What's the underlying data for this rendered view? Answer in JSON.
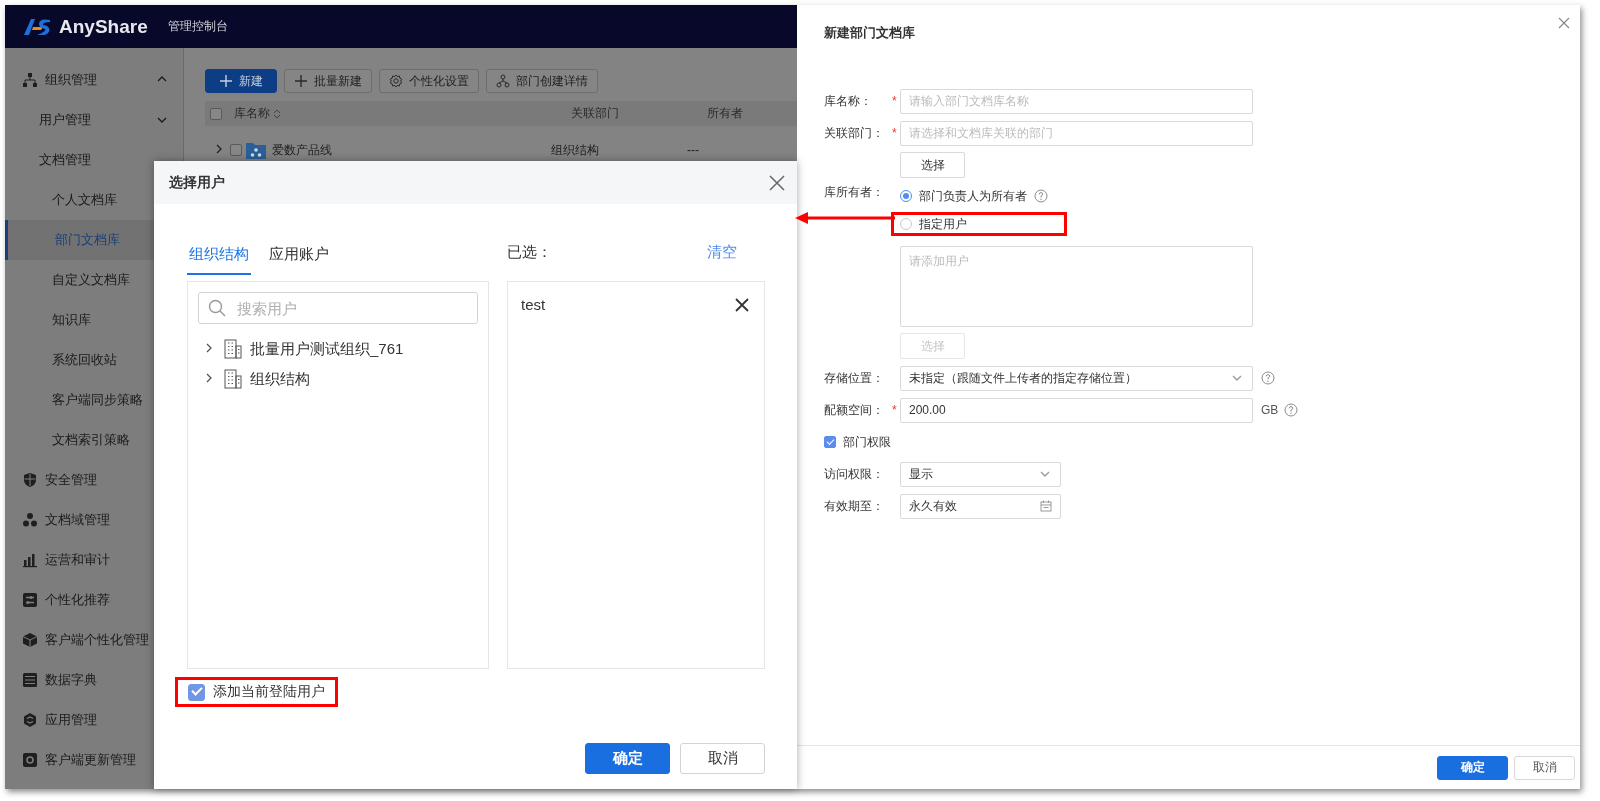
{
  "header": {
    "brand": "AnyShare",
    "subtitle": "管理控制台"
  },
  "sidebar": {
    "items": [
      {
        "label": "组织管理",
        "selected": false,
        "expanded": true,
        "children": [
          {
            "label": "用户管理",
            "selected": false,
            "expanded": false
          },
          {
            "label": "文档管理",
            "selected": false,
            "children": [
              {
                "label": "个人文档库",
                "selected": false
              },
              {
                "label": "部门文档库",
                "selected": true
              },
              {
                "label": "自定义文档库",
                "selected": false
              },
              {
                "label": "知识库",
                "selected": false
              },
              {
                "label": "系统回收站",
                "selected": false
              },
              {
                "label": "客户端同步策略",
                "selected": false
              },
              {
                "label": "文档索引策略",
                "selected": false
              }
            ]
          }
        ]
      },
      {
        "label": "安全管理",
        "selected": false
      },
      {
        "label": "文档域管理",
        "selected": false
      },
      {
        "label": "运营和审计",
        "selected": false
      },
      {
        "label": "个性化推荐",
        "selected": false
      },
      {
        "label": "客户端个性化管理",
        "selected": false
      },
      {
        "label": "数据字典",
        "selected": false
      },
      {
        "label": "应用管理",
        "selected": false
      },
      {
        "label": "客户端更新管理",
        "selected": false
      }
    ]
  },
  "toolbar": {
    "buttons": [
      {
        "label": "新建",
        "kind": "primary"
      },
      {
        "label": "批量新建",
        "kind": "default"
      },
      {
        "label": "个性化设置",
        "kind": "default"
      },
      {
        "label": "部门创建详情",
        "kind": "default"
      }
    ]
  },
  "table": {
    "all_checked": false,
    "columns": [
      {
        "label": "库名称",
        "sortable": true
      },
      {
        "label": "关联部门",
        "sortable": false
      },
      {
        "label": "所有者",
        "sortable": false
      }
    ],
    "rows": [
      {
        "checked": false,
        "expanded": false,
        "cells": [
          "爱数产品线",
          "组织结构",
          "---"
        ]
      }
    ]
  },
  "dialog": {
    "title": "选择用户",
    "tabs": [
      {
        "label": "组织结构",
        "selected": true
      },
      {
        "label": "应用账户",
        "selected": false
      }
    ],
    "selected_heading": "已选：",
    "clear_link": "清空",
    "search": {
      "placeholder": "搜索用户"
    },
    "tree": [
      {
        "label": "批量用户测试组织_761",
        "expanded": false
      },
      {
        "label": "组织结构",
        "expanded": false
      }
    ],
    "selected_users": [
      {
        "label": "test"
      }
    ],
    "add_current_user": {
      "label": "添加当前登陆用户",
      "checked": true,
      "highlighted": true
    },
    "buttons": [
      {
        "label": "确定",
        "kind": "primary"
      },
      {
        "label": "取消",
        "kind": "default"
      }
    ]
  },
  "drawer": {
    "title": "新建部门文档库",
    "form": [
      {
        "kind": "input",
        "label": "库名称：",
        "required_mark": "*",
        "placeholder": "请输入部门文档库名称"
      },
      {
        "kind": "input",
        "label": "关联部门：",
        "required_mark": "*",
        "placeholder": "请选择和文档库关联的部门"
      },
      {
        "kind": "button",
        "label": "选择",
        "disabled": false
      },
      {
        "kind": "radio",
        "label": "库所有者：",
        "options": [
          {
            "label": "部门负责人为所有者",
            "selected": true,
            "help": true,
            "highlighted": false
          },
          {
            "label": "指定用户",
            "selected": false,
            "highlighted": true
          }
        ]
      },
      {
        "kind": "textarea",
        "placeholder": "请添加用户"
      },
      {
        "kind": "button",
        "label": "选择",
        "disabled": true
      },
      {
        "kind": "select",
        "label": "存储位置：",
        "value": "未指定（跟随文件上传者的指定存储位置）",
        "help": true
      },
      {
        "kind": "input",
        "label": "配额空间：",
        "required_mark": "*",
        "value": "200.00",
        "suffix": "GB",
        "help": true
      },
      {
        "kind": "checkbox",
        "label": "部门权限",
        "checked": true,
        "children": [
          {
            "kind": "select",
            "label": "访问权限：",
            "value": "显示"
          },
          {
            "kind": "date",
            "label": "有效期至：",
            "value": "永久有效"
          }
        ]
      }
    ],
    "buttons": [
      {
        "label": "确定",
        "kind": "primary"
      },
      {
        "label": "取消",
        "kind": "default"
      }
    ]
  }
}
